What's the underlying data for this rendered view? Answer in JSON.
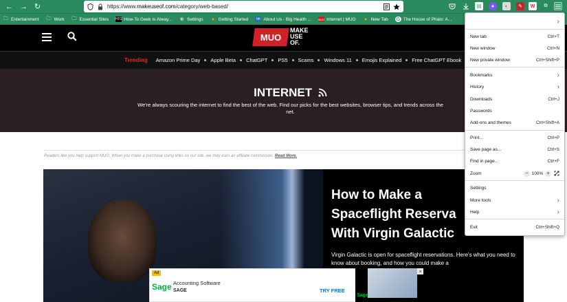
{
  "browser": {
    "url_prefix": "https://www.",
    "url_host": "makeuseof.com",
    "url_path": "/category/web-based/",
    "back_glyph": "←",
    "forward_glyph": "→",
    "reload_glyph": "↻",
    "bookmarks": [
      {
        "label": "Entertainment",
        "icon": "folder-icon"
      },
      {
        "label": "Work",
        "icon": "folder-icon"
      },
      {
        "label": "Essential Sites",
        "icon": "folder-icon"
      },
      {
        "label": "How-To Geek Is Alway...",
        "icon": "htg-icon"
      },
      {
        "label": "Settings",
        "icon": "globe-icon"
      },
      {
        "label": "Getting Started",
        "icon": "firefox-icon"
      },
      {
        "label": "About Us - Big Health ...",
        "icon": "bh-icon"
      },
      {
        "label": "Internet | MUO",
        "icon": "muo-icon"
      },
      {
        "label": "New Tab",
        "icon": "firefox-icon"
      },
      {
        "label": "The House of Phalo: A...",
        "icon": "google-icon"
      }
    ]
  },
  "site": {
    "logo_mark": "MUO",
    "logo_line1": "MAKE",
    "logo_line2": "USE",
    "logo_line3": "OF.",
    "trending_label": "Trending",
    "trending": [
      "Amazon Prime Day",
      "Apple Beta",
      "ChatGPT",
      "PS5",
      "Scams",
      "Windows 11",
      "Emojis Explained",
      "Free ChatGPT Ebook"
    ],
    "hero_title": "INTERNET",
    "hero_desc": "We're always scouring the internet to find the best of the web. Find our picks for the best websites, browser tips, and trends across the net.",
    "disclaimer": "Readers like you help support MUO. When you make a purchase using links on our site, we may earn an affiliate commission.",
    "disclaimer_link": "Read More.",
    "article_title_1": "How to Make a",
    "article_title_2": "Spaceflight Reserva",
    "article_title_3": "With Virgin Galactic",
    "article_desc": "Virgin Galactic is open for spaceflight reservations. Here's what you need to know about booking, and how you could make a"
  },
  "ad": {
    "tag": "Ad",
    "brand": "Sage",
    "line1": "Accounting Software",
    "line2": "SAGE",
    "cta": "TRY FREE",
    "side_brand": "Sage",
    "close": "✕"
  },
  "menu": {
    "new_tab": "New tab",
    "new_tab_sc": "Ctrl+T",
    "new_window": "New window",
    "new_window_sc": "Ctrl+N",
    "new_private": "New private window",
    "new_private_sc": "Ctrl+Shift+P",
    "bookmarks": "Bookmarks",
    "history": "History",
    "downloads": "Downloads",
    "downloads_sc": "Ctrl+J",
    "passwords": "Passwords",
    "addons": "Add-ons and themes",
    "addons_sc": "Ctrl+Shift+A",
    "print": "Print...",
    "print_sc": "Ctrl+P",
    "save": "Save page as...",
    "save_sc": "Ctrl+S",
    "find": "Find in page...",
    "find_sc": "Ctrl+F",
    "zoom": "Zoom",
    "zoom_minus": "−",
    "zoom_value": "100%",
    "zoom_plus": "+",
    "settings": "Settings",
    "more_tools": "More tools",
    "help": "Help",
    "exit": "Exit",
    "exit_sc": "Ctrl+Shift+Q"
  },
  "colors": {
    "toolbar": "#2a8a5e",
    "accent": "#d12027"
  }
}
